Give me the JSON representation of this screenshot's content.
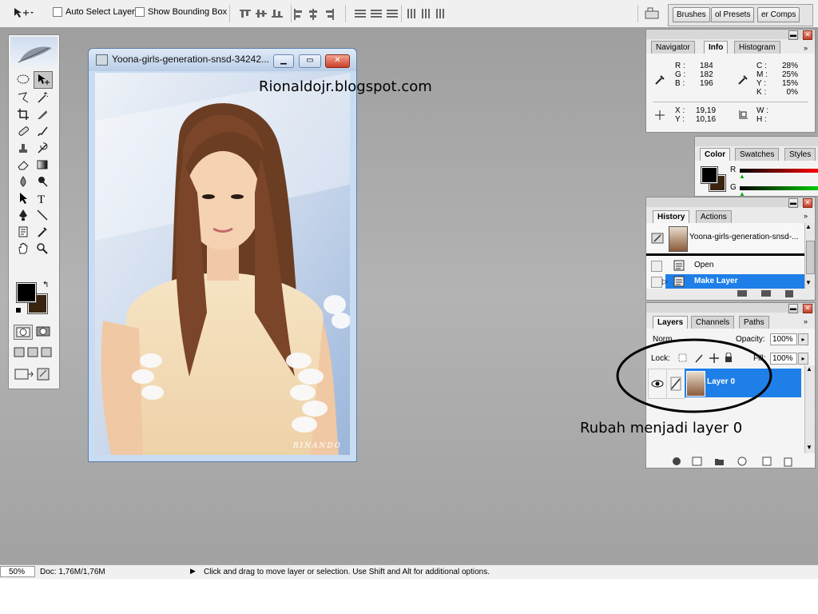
{
  "optionsbar": {
    "auto_select_label": "Auto Select Layer",
    "show_bounding_label": "Show Bounding Box",
    "well_tabs": [
      "Brushes",
      "ol Presets",
      "er Comps"
    ]
  },
  "document": {
    "title": "Yoona-girls-generation-snsd-34242...",
    "watermark": "Rionaldojr.blogspot.com",
    "signature": "RINANDO"
  },
  "info_panel": {
    "tabs": [
      "Navigator",
      "Info",
      "Histogram"
    ],
    "active_tab": "Info",
    "rgb": {
      "R": "184",
      "G": "182",
      "B": "196"
    },
    "cmyk": {
      "C": "28%",
      "M": "25%",
      "Y": "15%",
      "K": "0%"
    },
    "xy": {
      "X": "19,19",
      "Y": "10,16"
    },
    "wh": {
      "W": "",
      "H": ""
    },
    "labels": {
      "r": "R :",
      "g": "G :",
      "b": "B :",
      "c": "C :",
      "m": "M :",
      "y": "Y :",
      "k": "K :",
      "x": "X :",
      "yy": "Y :",
      "w": "W :",
      "h": "H :"
    }
  },
  "color_panel": {
    "tabs": [
      "Color",
      "Swatches",
      "Styles"
    ],
    "active_tab": "Color",
    "r_label": "R",
    "g_label": "G"
  },
  "history_panel": {
    "tabs": [
      "History",
      "Actions"
    ],
    "active_tab": "History",
    "snapshot_name": "Yoona-girls-generation-snsd-...",
    "items": [
      "Open",
      "Make Layer"
    ],
    "selected": "Make Layer"
  },
  "layers_panel": {
    "tabs": [
      "Layers",
      "Channels",
      "Paths"
    ],
    "active_tab": "Layers",
    "blend_mode": "Norm",
    "opacity_label": "Opacity:",
    "opacity_value": "100%",
    "lock_label": "Lock:",
    "fill_label": "Fill:",
    "fill_value": "100%",
    "layer_name": "Layer 0"
  },
  "annotation": {
    "caption": "Rubah menjadi layer 0"
  },
  "statusbar": {
    "zoom": "50%",
    "doc_size": "Doc: 1,76M/1,76M",
    "hint": "Click and drag to move layer or selection.  Use Shift and Alt for additional options."
  },
  "colors": {
    "selection_blue": "#1e7fe8",
    "foreground": "#000000",
    "background": "#3a2410"
  }
}
